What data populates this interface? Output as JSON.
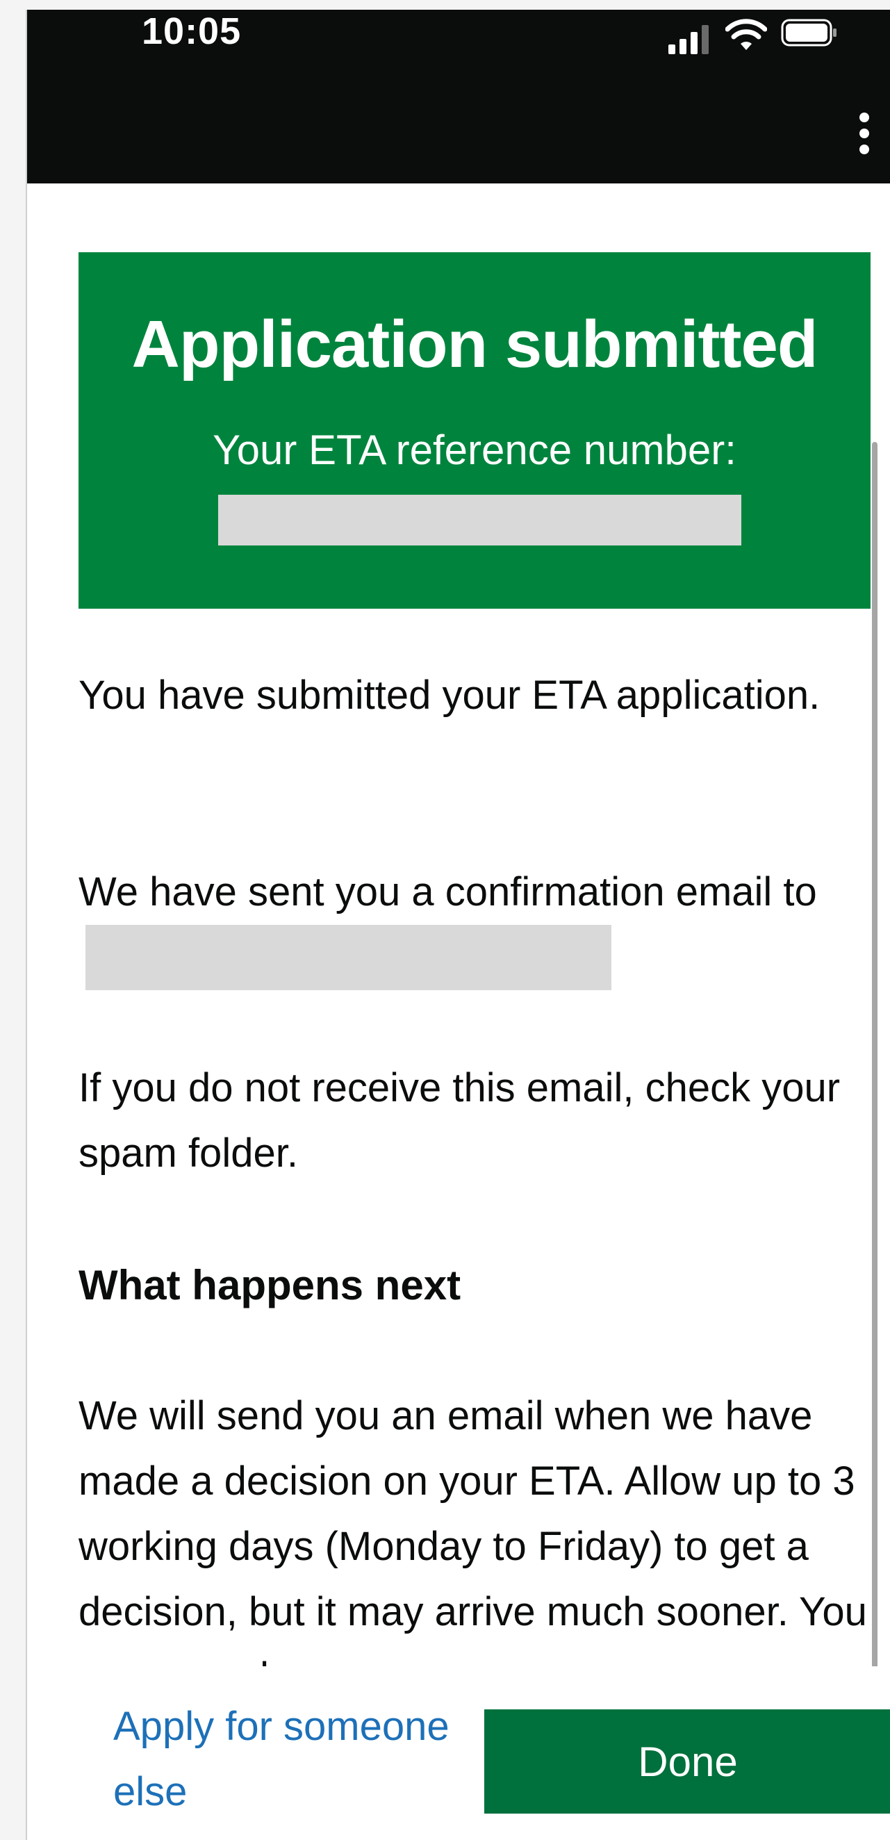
{
  "status_bar": {
    "time": "10:05",
    "icons": [
      "cellular-signal-icon",
      "wifi-icon",
      "battery-icon"
    ]
  },
  "header": {
    "menu_icon": "vertical-ellipsis-icon"
  },
  "panel": {
    "title": "Application submitted",
    "reference_label": "Your ETA reference number:",
    "reference_value": ""
  },
  "content": {
    "paragraph_1": "You have submitted your ETA application.",
    "paragraph_2_prefix": "We have sent you a confirmation email to",
    "paragraph_2_email": "",
    "paragraph_3": "If you do not receive this email, check your spam folder.",
    "heading_next": "What happens next",
    "paragraph_4": "We will send you an email when we have made a decision on your ETA. Allow up to 3 working days (Monday to Friday) to get a decision, but it may arrive much sooner. You can now close"
  },
  "footer": {
    "apply_link": "Apply for someone else",
    "done_button": "Done"
  },
  "colors": {
    "panel_green": "#00843d",
    "button_green": "#00703c",
    "link_blue": "#1d70b8",
    "header_black": "#0b0c0c"
  }
}
